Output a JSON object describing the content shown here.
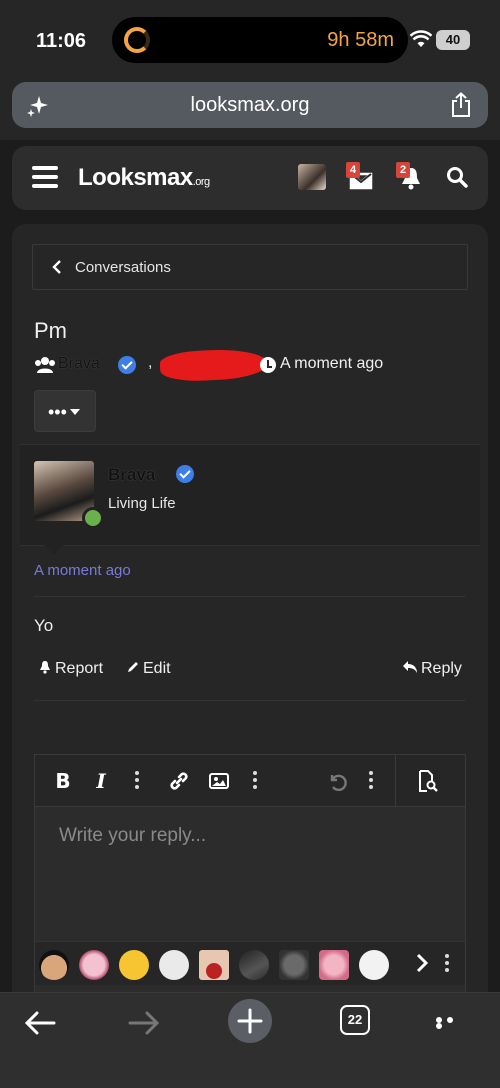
{
  "status_bar": {
    "time": "11:06",
    "timer": "9h 58m",
    "battery": "40"
  },
  "browser": {
    "url": "looksmax.org",
    "tabs_count": "22"
  },
  "header": {
    "logo": "Looksmax",
    "logo_suffix": ".org",
    "inbox_badge": "4",
    "alerts_badge": "2"
  },
  "breadcrumb": {
    "label": "Conversations"
  },
  "conversation": {
    "title": "Pm",
    "participant_1": "Brava",
    "separator": ",",
    "started": "A moment ago",
    "more_label": "•••"
  },
  "message": {
    "username": "Brava",
    "user_title": "Living Life",
    "time": "A moment ago",
    "body": "Yo",
    "actions": {
      "report": "Report",
      "edit": "Edit",
      "reply": "Reply"
    }
  },
  "editor": {
    "placeholder": "Write your reply...",
    "bold": "B",
    "italic": "I"
  },
  "icons": [
    "timer-icon",
    "wifi-icon",
    "battery-icon",
    "sparkle-icon",
    "share-icon",
    "hamburger-icon",
    "inbox-icon",
    "bell-icon",
    "search-icon",
    "chevron-left-icon",
    "users-icon",
    "verified-icon",
    "clock-icon",
    "flag-icon",
    "pencil-icon",
    "reply-icon",
    "link-icon",
    "image-icon",
    "undo-icon",
    "preview-icon",
    "back-icon",
    "forward-icon",
    "plus-icon",
    "menu-dots-icon"
  ],
  "colors": {
    "accent": "#3d7fe6",
    "badge": "#d6453a",
    "online": "#6ab04c",
    "timestamp": "#7a7ad6"
  }
}
